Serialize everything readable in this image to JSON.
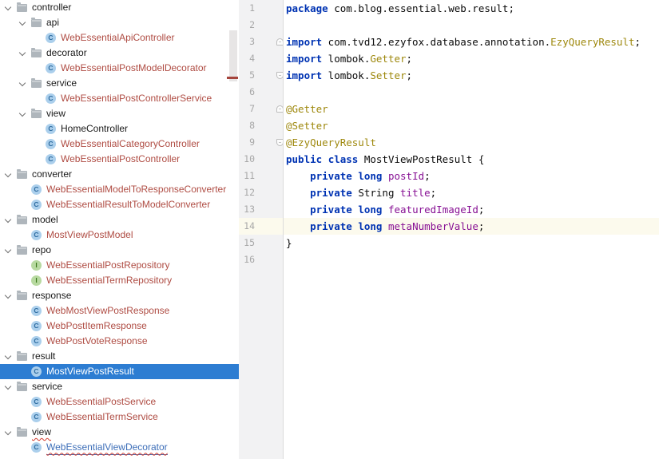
{
  "colors": {
    "selection": "#2D7DD2",
    "vcs_red": "#AF4C43",
    "vcs_blue": "#3D6EB8",
    "error_squiggle": "#D23B2E",
    "stripe_red": "#A5443C",
    "gutter_bg": "#F2F2F3",
    "line_number": "#A8A8A8",
    "caret_row": "#FCFAED",
    "keyword": "#0033B3",
    "annotation": "#9E880D",
    "field": "#871094",
    "plain": "#0A0A0A"
  },
  "icons": {
    "class_letter": "C",
    "interface_letter": "I",
    "folder": "folder-icon",
    "chevron": "chevron-down-icon"
  },
  "tree": {
    "items": [
      {
        "label": "controller",
        "type": "folder",
        "level": 0
      },
      {
        "label": "api",
        "type": "folder",
        "level": 1
      },
      {
        "label": "WebEssentialApiController",
        "type": "class",
        "level": 2,
        "color": "red"
      },
      {
        "label": "decorator",
        "type": "folder",
        "level": 1
      },
      {
        "label": "WebEssentialPostModelDecorator",
        "type": "class",
        "level": 2,
        "color": "red"
      },
      {
        "label": "service",
        "type": "folder",
        "level": 1
      },
      {
        "label": "WebEssentialPostControllerService",
        "type": "class",
        "level": 2,
        "color": "red"
      },
      {
        "label": "view",
        "type": "folder",
        "level": 1
      },
      {
        "label": "HomeController",
        "type": "class",
        "level": 2
      },
      {
        "label": "WebEssentialCategoryController",
        "type": "class",
        "level": 2,
        "color": "red"
      },
      {
        "label": "WebEssentialPostController",
        "type": "class",
        "level": 2,
        "color": "red"
      },
      {
        "label": "converter",
        "type": "folder",
        "level": 0
      },
      {
        "label": "WebEssentialModelToResponseConverter",
        "type": "class",
        "level": 1,
        "color": "red"
      },
      {
        "label": "WebEssentialResultToModelConverter",
        "type": "class",
        "level": 1,
        "color": "red"
      },
      {
        "label": "model",
        "type": "folder",
        "level": 0
      },
      {
        "label": "MostViewPostModel",
        "type": "class",
        "level": 1,
        "color": "red"
      },
      {
        "label": "repo",
        "type": "folder",
        "level": 0
      },
      {
        "label": "WebEssentialPostRepository",
        "type": "interface",
        "level": 1,
        "color": "red"
      },
      {
        "label": "WebEssentialTermRepository",
        "type": "interface",
        "level": 1,
        "color": "red"
      },
      {
        "label": "response",
        "type": "folder",
        "level": 0
      },
      {
        "label": "WebMostViewPostResponse",
        "type": "class",
        "level": 1,
        "color": "red"
      },
      {
        "label": "WebPostItemResponse",
        "type": "class",
        "level": 1,
        "color": "red"
      },
      {
        "label": "WebPostVoteResponse",
        "type": "class",
        "level": 1,
        "color": "red"
      },
      {
        "label": "result",
        "type": "folder",
        "level": 0
      },
      {
        "label": "MostViewPostResult",
        "type": "class",
        "level": 1,
        "selected": true
      },
      {
        "label": "service",
        "type": "folder",
        "level": 0
      },
      {
        "label": "WebEssentialPostService",
        "type": "class",
        "level": 1,
        "color": "red"
      },
      {
        "label": "WebEssentialTermService",
        "type": "class",
        "level": 1,
        "color": "red"
      },
      {
        "label": "view",
        "type": "folder",
        "level": 0,
        "squiggle": true
      },
      {
        "label": "WebEssentialViewDecorator",
        "type": "class",
        "level": 1,
        "color": "blue",
        "squiggle": true
      }
    ]
  },
  "editor": {
    "current_line": 14,
    "lines": [
      {
        "n": 1,
        "t": [
          [
            "kw",
            "package"
          ],
          [
            "pl",
            " com.blog.essential.web.result;"
          ]
        ]
      },
      {
        "n": 2,
        "t": []
      },
      {
        "n": 3,
        "fold": "start",
        "t": [
          [
            "kw",
            "import"
          ],
          [
            "pl",
            " com.tvd12.ezyfox.database.annotation."
          ],
          [
            "ann",
            "EzyQueryResult"
          ],
          [
            "pl",
            ";"
          ]
        ]
      },
      {
        "n": 4,
        "t": [
          [
            "kw",
            "import"
          ],
          [
            "pl",
            " lombok."
          ],
          [
            "ann",
            "Getter"
          ],
          [
            "pl",
            ";"
          ]
        ]
      },
      {
        "n": 5,
        "fold": "end",
        "t": [
          [
            "kw",
            "import"
          ],
          [
            "pl",
            " lombok."
          ],
          [
            "ann",
            "Setter"
          ],
          [
            "pl",
            ";"
          ]
        ]
      },
      {
        "n": 6,
        "t": []
      },
      {
        "n": 7,
        "fold": "start",
        "t": [
          [
            "ann",
            "@Getter"
          ]
        ]
      },
      {
        "n": 8,
        "t": [
          [
            "ann",
            "@Setter"
          ]
        ]
      },
      {
        "n": 9,
        "fold": "end",
        "t": [
          [
            "ann",
            "@EzyQueryResult"
          ]
        ]
      },
      {
        "n": 10,
        "t": [
          [
            "kw",
            "public"
          ],
          [
            "pl",
            " "
          ],
          [
            "kw",
            "class"
          ],
          [
            "pl",
            " MostViewPostResult {"
          ]
        ]
      },
      {
        "n": 11,
        "t": [
          [
            "pl",
            "    "
          ],
          [
            "kw",
            "private"
          ],
          [
            "pl",
            " "
          ],
          [
            "kw",
            "long"
          ],
          [
            "pl",
            " "
          ],
          [
            "fld",
            "postId"
          ],
          [
            "pl",
            ";"
          ]
        ]
      },
      {
        "n": 12,
        "t": [
          [
            "pl",
            "    "
          ],
          [
            "kw",
            "private"
          ],
          [
            "pl",
            " String "
          ],
          [
            "fld",
            "title"
          ],
          [
            "pl",
            ";"
          ]
        ]
      },
      {
        "n": 13,
        "t": [
          [
            "pl",
            "    "
          ],
          [
            "kw",
            "private"
          ],
          [
            "pl",
            " "
          ],
          [
            "kw",
            "long"
          ],
          [
            "pl",
            " "
          ],
          [
            "fld",
            "featuredImageId"
          ],
          [
            "pl",
            ";"
          ]
        ]
      },
      {
        "n": 14,
        "t": [
          [
            "pl",
            "    "
          ],
          [
            "kw",
            "private"
          ],
          [
            "pl",
            " "
          ],
          [
            "kw",
            "long"
          ],
          [
            "pl",
            " "
          ],
          [
            "fld",
            "metaNumberValue"
          ],
          [
            "pl",
            ";"
          ]
        ]
      },
      {
        "n": 15,
        "t": [
          [
            "pl",
            "}"
          ]
        ]
      },
      {
        "n": 16,
        "t": []
      }
    ]
  }
}
